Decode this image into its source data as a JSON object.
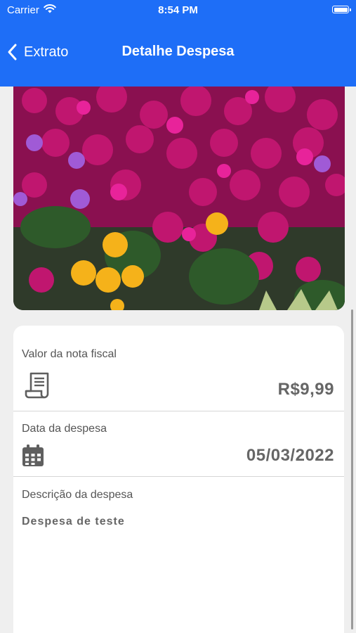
{
  "status_bar": {
    "carrier": "Carrier",
    "time": "8:54 PM"
  },
  "nav": {
    "back_label": "Extrato",
    "title": "Detalhe Despesa"
  },
  "colors": {
    "header": "#1e6ef7",
    "value_text": "#666666",
    "card": "#ffffff",
    "background": "#efefef"
  },
  "receipt_photo": {
    "subject": "flowers"
  },
  "details": {
    "invoice": {
      "label": "Valor da nota fiscal",
      "value": "R$9,99",
      "icon": "receipt-icon"
    },
    "date": {
      "label": "Data da despesa",
      "value": "05/03/2022",
      "icon": "calendar-icon"
    },
    "description": {
      "label": "Descrição da despesa",
      "value": "Despesa de teste"
    }
  }
}
